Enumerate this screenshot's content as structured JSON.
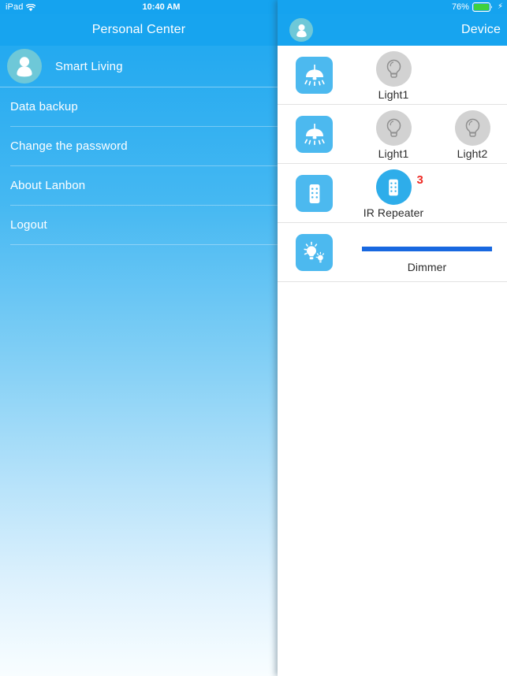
{
  "status_bar": {
    "device_label": "iPad",
    "wifi_icon": "wifi-icon",
    "time": "10:40 AM",
    "battery_percent": "76%",
    "battery_icon": "battery-icon",
    "charging_icon": "lightning-bolt-icon"
  },
  "left_panel": {
    "header": {
      "title": "Personal Center"
    },
    "profile": {
      "avatar_icon": "person-avatar-icon",
      "name": "Smart Living"
    },
    "menu": [
      {
        "label": "Data backup"
      },
      {
        "label": "Change the password"
      },
      {
        "label": "About Lanbon"
      },
      {
        "label": "Logout"
      }
    ]
  },
  "right_panel": {
    "header": {
      "avatar_icon": "person-avatar-icon",
      "title": "Device"
    },
    "devices": [
      {
        "category_icon": "pendant-lamp-icon",
        "type": "toggle",
        "items": [
          {
            "label": "Light1",
            "icon": "bulb-icon",
            "state": "off",
            "badge": ""
          }
        ]
      },
      {
        "category_icon": "pendant-lamp-icon",
        "type": "toggle",
        "items": [
          {
            "label": "Light1",
            "icon": "bulb-icon",
            "state": "off",
            "badge": ""
          },
          {
            "label": "Light2",
            "icon": "bulb-icon",
            "state": "off",
            "badge": ""
          }
        ]
      },
      {
        "category_icon": "remote-control-icon",
        "type": "toggle",
        "items": [
          {
            "label": "IR Repeater",
            "icon": "remote-control-icon",
            "state": "on",
            "badge": "3"
          }
        ]
      },
      {
        "category_icon": "dimmer-bulbs-icon",
        "type": "slider",
        "slider": {
          "label": "Dimmer",
          "value": 100,
          "min": 0,
          "max": 100
        }
      }
    ]
  },
  "colors": {
    "accent_blue": "#17a4ef",
    "status_bar_blue": "#15a3ef",
    "category_tile_blue": "#4cb9ef",
    "bulb_off_gray": "#d2d2d2",
    "bulb_on_blue": "#2eadea",
    "slider_fill": "#1868e0",
    "badge_red": "#ee2a24",
    "avatar_teal": "#6ec8d8"
  }
}
